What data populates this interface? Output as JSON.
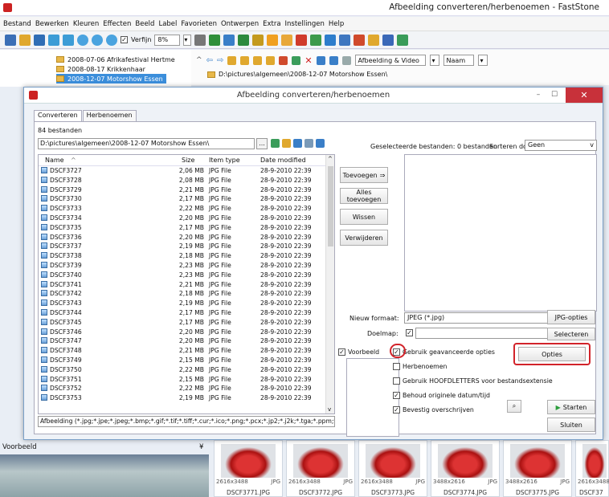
{
  "app": {
    "title": "Afbeelding converteren/herbenoemen - FastStone"
  },
  "menu": [
    "Bestand",
    "Bewerken",
    "Kleuren",
    "Effecten",
    "Beeld",
    "Label",
    "Favorieten",
    "Ontwerpen",
    "Extra",
    "Instellingen",
    "Help"
  ],
  "toolbar": {
    "smooth_label": "Verfijn",
    "zoom": "8%",
    "view_filter": "Afbeelding & Video",
    "sort": "Naam"
  },
  "tree": [
    "2008-07-06 Afrikafestival Hertme",
    "2008-08-17 Krikkenhaar",
    "2008-12-07 Motorshow Essen"
  ],
  "browser": {
    "path": "D:\\pictures\\algemeen\\2008-12-07 Motorshow Essen\\"
  },
  "preview": {
    "label": "Voorbeeld",
    "collapse": "¥"
  },
  "thumbs": [
    {
      "dims": "2616x3488",
      "type": "JPG",
      "name": "DSCF3771.JPG"
    },
    {
      "dims": "2616x3488",
      "type": "JPG",
      "name": "DSCF3772.JPG"
    },
    {
      "dims": "2616x3488",
      "type": "JPG",
      "name": "DSCF3773.JPG"
    },
    {
      "dims": "3488x2616",
      "type": "JPG",
      "name": "DSCF3774.JPG"
    },
    {
      "dims": "3488x2616",
      "type": "JPG",
      "name": "DSCF3775.JPG"
    },
    {
      "dims": "2616x3488",
      "type": "",
      "name": "DSCF37"
    }
  ],
  "dialog": {
    "title": "Afbeelding converteren/herbenoemen",
    "tabs": [
      "Converteren",
      "Herbenoemen"
    ],
    "count": "84 bestanden",
    "path": "D:\\pictures\\algemeen\\2008-12-07 Motorshow Essen\\",
    "path_button": "...",
    "columns": {
      "name": "Name",
      "size": "Size",
      "type": "Item type",
      "date": "Date modified"
    },
    "files": [
      [
        "DSCF3727",
        "2,06 MB",
        "JPG File",
        "28-9-2010 22:39"
      ],
      [
        "DSCF3728",
        "2,08 MB",
        "JPG File",
        "28-9-2010 22:39"
      ],
      [
        "DSCF3729",
        "2,21 MB",
        "JPG File",
        "28-9-2010 22:39"
      ],
      [
        "DSCF3730",
        "2,17 MB",
        "JPG File",
        "28-9-2010 22:39"
      ],
      [
        "DSCF3733",
        "2,22 MB",
        "JPG File",
        "28-9-2010 22:39"
      ],
      [
        "DSCF3734",
        "2,20 MB",
        "JPG File",
        "28-9-2010 22:39"
      ],
      [
        "DSCF3735",
        "2,17 MB",
        "JPG File",
        "28-9-2010 22:39"
      ],
      [
        "DSCF3736",
        "2,20 MB",
        "JPG File",
        "28-9-2010 22:39"
      ],
      [
        "DSCF3737",
        "2,19 MB",
        "JPG File",
        "28-9-2010 22:39"
      ],
      [
        "DSCF3738",
        "2,18 MB",
        "JPG File",
        "28-9-2010 22:39"
      ],
      [
        "DSCF3739",
        "2,23 MB",
        "JPG File",
        "28-9-2010 22:39"
      ],
      [
        "DSCF3740",
        "2,23 MB",
        "JPG File",
        "28-9-2010 22:39"
      ],
      [
        "DSCF3741",
        "2,21 MB",
        "JPG File",
        "28-9-2010 22:39"
      ],
      [
        "DSCF3742",
        "2,18 MB",
        "JPG File",
        "28-9-2010 22:39"
      ],
      [
        "DSCF3743",
        "2,19 MB",
        "JPG File",
        "28-9-2010 22:39"
      ],
      [
        "DSCF3744",
        "2,17 MB",
        "JPG File",
        "28-9-2010 22:39"
      ],
      [
        "DSCF3745",
        "2,17 MB",
        "JPG File",
        "28-9-2010 22:39"
      ],
      [
        "DSCF3746",
        "2,20 MB",
        "JPG File",
        "28-9-2010 22:39"
      ],
      [
        "DSCF3747",
        "2,20 MB",
        "JPG File",
        "28-9-2010 22:39"
      ],
      [
        "DSCF3748",
        "2,21 MB",
        "JPG File",
        "28-9-2010 22:39"
      ],
      [
        "DSCF3749",
        "2,15 MB",
        "JPG File",
        "28-9-2010 22:39"
      ],
      [
        "DSCF3750",
        "2,22 MB",
        "JPG File",
        "28-9-2010 22:39"
      ],
      [
        "DSCF3751",
        "2,15 MB",
        "JPG File",
        "28-9-2010 22:39"
      ],
      [
        "DSCF3752",
        "2,22 MB",
        "JPG File",
        "28-9-2010 22:39"
      ],
      [
        "DSCF3753",
        "2,19 MB",
        "JPG File",
        "28-9-2010 22:39"
      ]
    ],
    "filter": "Afbeelding (*.jpg;*.jpe;*.jpeg;*.bmp;*.gif;*.tif;*.tiff;*.cur;*.ico;*.png;*.pcx;*.jp2;*.j2k;*.tga;*.ppm;*.wmf;*.",
    "buttons": {
      "add": "Toevoegen",
      "add_all": "Alles toevoegen",
      "clear": "Wissen",
      "remove": "Verwijderen",
      "jpg_options": "JPG-opties",
      "select": "Selecteren",
      "options": "Opties",
      "start": "Starten",
      "close": "Sluiten"
    },
    "selected_label": "Geselecteerde bestanden: 0 bestanden",
    "sort_label": "Sorteren door:",
    "sort_value": "Geen",
    "format_label": "Nieuw formaat:",
    "format_value": "JPEG (*.jpg)",
    "dest_label": "Doelmap:",
    "preview_label": "Voorbeeld",
    "options": [
      "Gebruik geavanceerde opties",
      "Herbenoemen",
      "Gebruik HOOFDLETTERS voor bestandsextensie",
      "Behoud originele datum/tijd",
      "Bevestig overschrijven"
    ],
    "options_checked": [
      true,
      false,
      false,
      true,
      true
    ]
  },
  "colors": {
    "highlight": "#d2232a",
    "close": "#c8313a"
  }
}
